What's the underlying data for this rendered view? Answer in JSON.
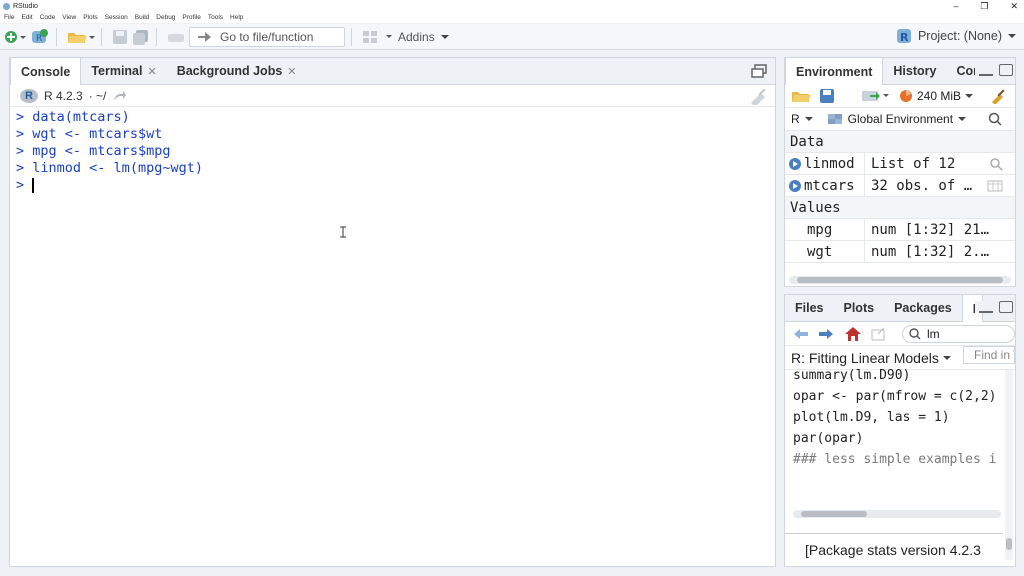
{
  "window": {
    "title": "RStudio"
  },
  "menu": [
    "File",
    "Edit",
    "Code",
    "View",
    "Plots",
    "Session",
    "Build",
    "Debug",
    "Profile",
    "Tools",
    "Help"
  ],
  "toolbar": {
    "goto_label": "Go to file/function",
    "addins_label": "Addins",
    "project_label": "Project: (None)"
  },
  "left_pane": {
    "tabs": [
      {
        "label": "Console"
      },
      {
        "label": "Terminal"
      },
      {
        "label": "Background Jobs"
      }
    ],
    "version": "R 4.2.3",
    "path": "· ~/",
    "lines": [
      "data(mtcars)",
      "wgt <- mtcars$wt",
      "mpg <- mtcars$mpg",
      "linmod <- lm(mpg~wgt)"
    ],
    "prompt": ">"
  },
  "env_pane": {
    "tabs": [
      {
        "label": "Environment"
      },
      {
        "label": "History"
      },
      {
        "label": "Cor"
      }
    ],
    "memory": "240 MiB",
    "language": "R",
    "scope": "Global Environment",
    "data_header": "Data",
    "values_header": "Values",
    "data_rows": [
      {
        "name": "linmod",
        "value": "List of  12"
      },
      {
        "name": "mtcars",
        "value": "32 obs. of …"
      }
    ],
    "value_rows": [
      {
        "name": "mpg",
        "value": "num [1:32] 21…"
      },
      {
        "name": "wgt",
        "value": "num [1:32] 2.…"
      }
    ]
  },
  "help_pane": {
    "tabs": [
      {
        "label": "Files"
      },
      {
        "label": "Plots"
      },
      {
        "label": "Packages"
      },
      {
        "label": "H"
      }
    ],
    "search_value": "lm",
    "topic": "R: Fitting Linear Models",
    "find_placeholder": "Find in T",
    "code_lines": [
      "summary(lm.D90)",
      "",
      "opar <- par(mfrow = c(2,2)",
      "plot(lm.D9, las = 1)",
      "par(opar)",
      "",
      "### less simple examples i"
    ],
    "footer": "[Package stats version 4.2.3"
  }
}
